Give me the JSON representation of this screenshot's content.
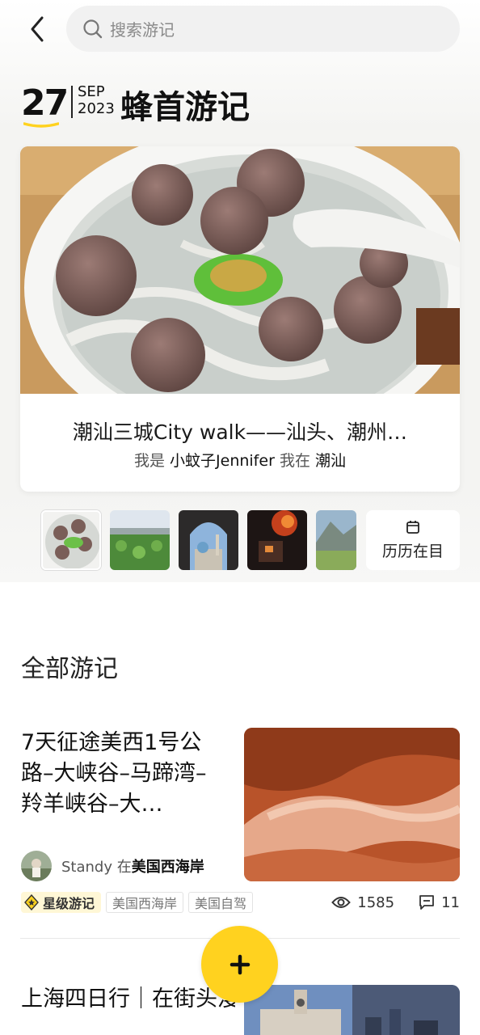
{
  "search": {
    "placeholder": "搜索游记"
  },
  "date_header": {
    "day": "27",
    "month": "SEP",
    "year": "2023",
    "title": "蜂首游记"
  },
  "featured": {
    "title": "潮汕三城City walk——汕头、潮州…",
    "author_prefix": "我是",
    "author": "小蚊子Jennifer",
    "location_prefix": "我在",
    "location": "潮汕"
  },
  "history_button": {
    "label": "历历在目"
  },
  "section": {
    "title": "全部游记"
  },
  "notes": [
    {
      "title": "7天征途美西1号公路–大峡谷–马蹄湾–羚羊峡谷–大…",
      "author": "Standy",
      "location_prefix": "在",
      "location": "美国西海岸",
      "star_tag": "星级游记",
      "tags": [
        "美国西海岸",
        "美国自驾"
      ],
      "views": "1585",
      "comments": "11"
    },
    {
      "title": "上海四日行｜在街头漫步，在博物馆看展"
    }
  ],
  "colors": {
    "accent": "#ffd21f",
    "star_tag_bg": "#fff7d6"
  },
  "icons": {
    "back": "chevron-left-icon",
    "search": "search-icon",
    "calendar": "calendar-icon",
    "eye": "eye-icon",
    "comment": "comment-icon",
    "add": "plus-icon",
    "star": "star-badge-icon"
  }
}
